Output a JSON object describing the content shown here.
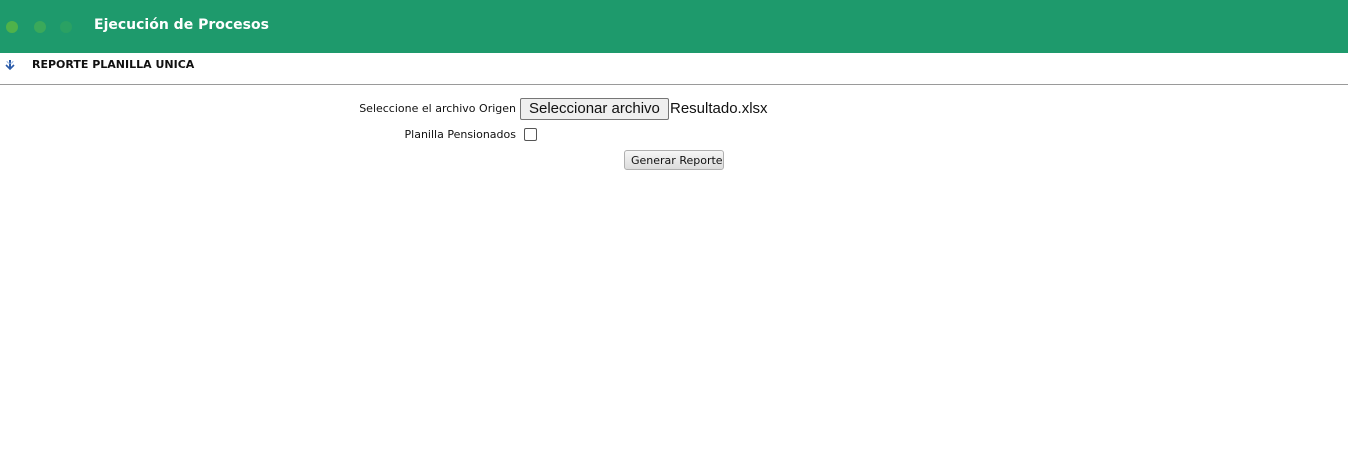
{
  "header": {
    "title": "Ejecución de Procesos",
    "color": "#1e9a6c"
  },
  "section": {
    "icon": "download-arrow-icon",
    "title": "REPORTE PLANILLA UNICA"
  },
  "form": {
    "file_label": "Seleccione el archivo Origen",
    "file_button_label": "Seleccionar archivo",
    "file_name": "Resultado.xlsx",
    "pensionados_label": "Planilla Pensionados",
    "pensionados_checked": false,
    "submit_label": "Generar Reporte"
  }
}
